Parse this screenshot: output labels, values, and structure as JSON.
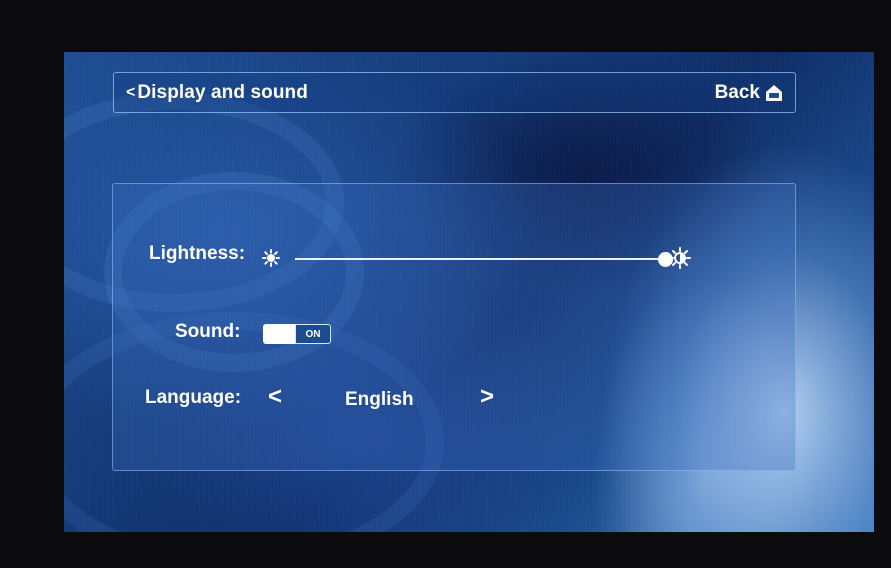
{
  "header": {
    "back_chevron": "<",
    "title": "Display and sound",
    "back_label": "Back",
    "back_icon": "home-icon"
  },
  "settings": {
    "lightness": {
      "label": "Lightness:",
      "value_percent": 100,
      "min_icon": "brightness-low-icon",
      "max_icon": "brightness-high-icon"
    },
    "sound": {
      "label": "Sound:",
      "state_text": "ON",
      "enabled": true
    },
    "language": {
      "label": "Language:",
      "prev_glyph": "<",
      "value": "English",
      "next_glyph": ">"
    }
  },
  "colors": {
    "text": "#ffffff",
    "accent": "#1b4c8f",
    "border": "#96c3f5"
  }
}
